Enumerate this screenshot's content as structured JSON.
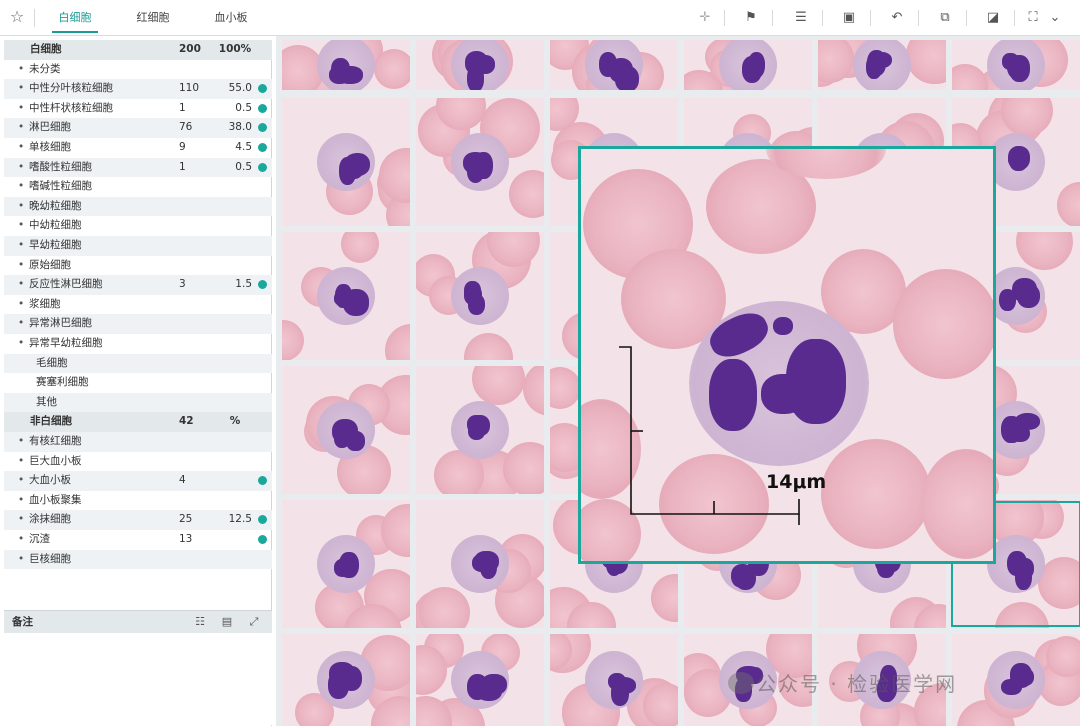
{
  "tabs": [
    {
      "label": "白细胞",
      "active": true
    },
    {
      "label": "红细胞",
      "active": false
    },
    {
      "label": "血小板",
      "active": false
    }
  ],
  "toolbar_icons": [
    "star-icon",
    "crosshair-icon",
    "flag-icon",
    "align-icon",
    "stamp-icon",
    "undo-icon",
    "copy-icon",
    "bookmark-icon",
    "fit-icon",
    "chevron-down-icon"
  ],
  "accent_color": "#1aa89c",
  "wbc": {
    "header": {
      "name": "白细胞",
      "count": "200",
      "percent": "100%"
    },
    "rows": [
      {
        "name": "未分类",
        "count": "",
        "percent": "",
        "dot": true,
        "marked": false
      },
      {
        "name": "中性分叶核粒细胞",
        "count": "110",
        "percent": "55.0",
        "dot": true,
        "marked": true
      },
      {
        "name": "中性杆状核粒细胞",
        "count": "1",
        "percent": "0.5",
        "dot": true,
        "marked": true
      },
      {
        "name": "淋巴细胞",
        "count": "76",
        "percent": "38.0",
        "dot": true,
        "marked": true
      },
      {
        "name": "单核细胞",
        "count": "9",
        "percent": "4.5",
        "dot": true,
        "marked": true
      },
      {
        "name": "嗜酸性粒细胞",
        "count": "1",
        "percent": "0.5",
        "dot": true,
        "marked": true
      },
      {
        "name": "嗜碱性粒细胞",
        "count": "",
        "percent": "",
        "dot": true,
        "marked": false
      },
      {
        "name": "晚幼粒细胞",
        "count": "",
        "percent": "",
        "dot": true,
        "marked": false
      },
      {
        "name": "中幼粒细胞",
        "count": "",
        "percent": "",
        "dot": true,
        "marked": false
      },
      {
        "name": "早幼粒细胞",
        "count": "",
        "percent": "",
        "dot": true,
        "marked": false
      },
      {
        "name": "原始细胞",
        "count": "",
        "percent": "",
        "dot": true,
        "marked": false
      },
      {
        "name": "反应性淋巴细胞",
        "count": "3",
        "percent": "1.5",
        "dot": true,
        "marked": true
      },
      {
        "name": "浆细胞",
        "count": "",
        "percent": "",
        "dot": true,
        "marked": false
      },
      {
        "name": "异常淋巴细胞",
        "count": "",
        "percent": "",
        "dot": true,
        "marked": false
      },
      {
        "name": "异常早幼粒细胞",
        "count": "",
        "percent": "",
        "dot": true,
        "marked": false
      },
      {
        "name": "毛细胞",
        "count": "",
        "percent": "",
        "dot": false,
        "marked": false
      },
      {
        "name": "赛塞利细胞",
        "count": "",
        "percent": "",
        "dot": false,
        "marked": false
      },
      {
        "name": "其他",
        "count": "",
        "percent": "",
        "dot": false,
        "marked": false
      }
    ]
  },
  "non_wbc": {
    "header": {
      "name": "非白细胞",
      "count": "42",
      "percent": "%"
    },
    "rows": [
      {
        "name": "有核红细胞",
        "count": "",
        "percent": "",
        "dot": true,
        "marked": false
      },
      {
        "name": "巨大血小板",
        "count": "",
        "percent": "",
        "dot": true,
        "marked": false
      },
      {
        "name": "大血小板",
        "count": "4",
        "percent": "",
        "dot": true,
        "marked": true
      },
      {
        "name": "血小板聚集",
        "count": "",
        "percent": "",
        "dot": true,
        "marked": false
      },
      {
        "name": "涂抹细胞",
        "count": "25",
        "percent": "12.5",
        "dot": true,
        "marked": true
      },
      {
        "name": "沉渣",
        "count": "13",
        "percent": "",
        "dot": true,
        "marked": true
      },
      {
        "name": "巨核细胞",
        "count": "",
        "percent": "",
        "dot": true,
        "marked": false
      }
    ]
  },
  "notes": {
    "title": "备注",
    "icons": [
      "list-edit-icon",
      "clipboard-icon",
      "expand-icon"
    ]
  },
  "zoom": {
    "scale_label": "14μm"
  },
  "watermark": {
    "text": "公众号 · 检验医学网"
  }
}
